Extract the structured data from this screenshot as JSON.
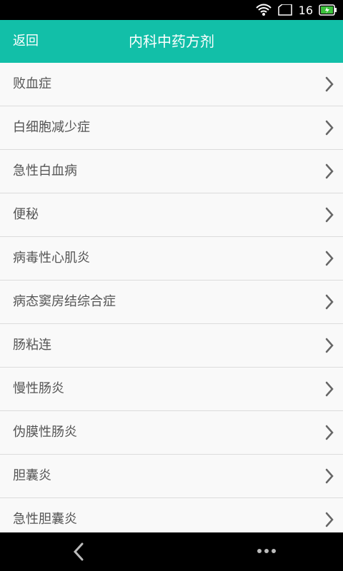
{
  "status_bar": {
    "time": "16",
    "icons": [
      "wifi-icon",
      "battery-outline-icon",
      "battery-charging-icon"
    ]
  },
  "header": {
    "back_label": "返回",
    "title": "内科中药方剂",
    "accent_color": "#12bfa8"
  },
  "list": {
    "items": [
      {
        "label": "败血症"
      },
      {
        "label": "白细胞减少症"
      },
      {
        "label": "急性白血病"
      },
      {
        "label": "便秘"
      },
      {
        "label": "病毒性心肌炎"
      },
      {
        "label": "病态窦房结综合症"
      },
      {
        "label": "肠粘连"
      },
      {
        "label": "慢性肠炎"
      },
      {
        "label": "伪膜性肠炎"
      },
      {
        "label": "胆囊炎"
      },
      {
        "label": "急性胆囊炎"
      }
    ]
  },
  "nav_bar": {
    "icons": [
      "back-arrow-icon",
      "more-dots-icon"
    ]
  }
}
